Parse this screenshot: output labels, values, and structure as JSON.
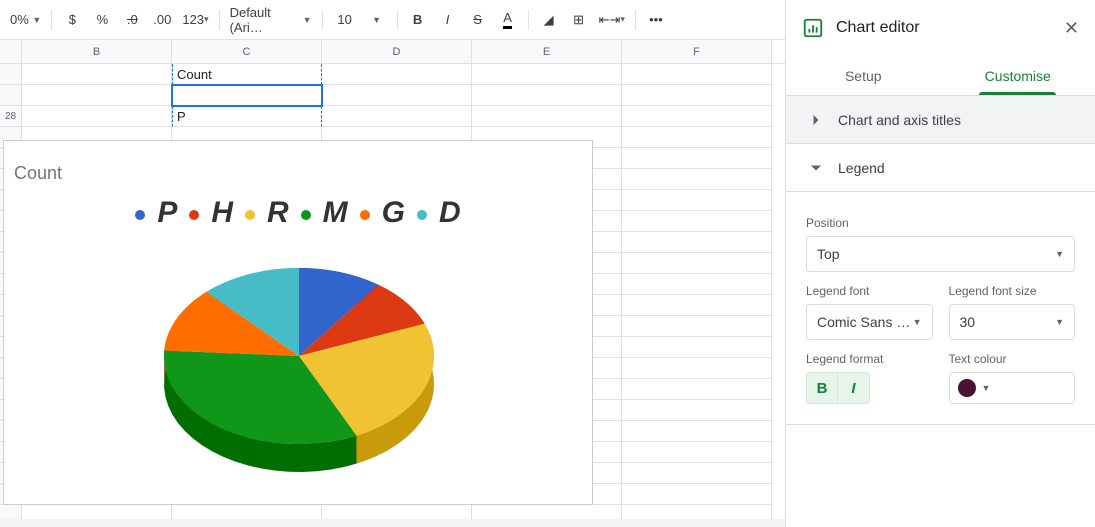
{
  "toolbar": {
    "pct": "0%",
    "currency": "$",
    "percent": "%",
    "dec_dec": ".0",
    "dec_inc": ".00",
    "fmt123": "123",
    "font_name": "Default (Ari…",
    "font_size": "10",
    "more": "•••"
  },
  "grid": {
    "cols": [
      "B",
      "C",
      "D",
      "E",
      "F"
    ],
    "c1": "Count",
    "c2": "P",
    "row3_label": "28"
  },
  "chart_data": {
    "type": "pie",
    "title": "Count",
    "legend_position": "top",
    "legend_font": "Comic Sans MS",
    "legend_font_size": 30,
    "legend_bold": true,
    "legend_italic": true,
    "series": [
      {
        "name": "P",
        "value": 10,
        "color": "#3366cc"
      },
      {
        "name": "H",
        "value": 9,
        "color": "#dc3912"
      },
      {
        "name": "R",
        "value": 24,
        "color": "#f1c232"
      },
      {
        "name": "M",
        "value": 33,
        "color": "#109618"
      },
      {
        "name": "G",
        "value": 12,
        "color": "#ff6d01"
      },
      {
        "name": "D",
        "value": 12,
        "color": "#46bdc6"
      }
    ]
  },
  "panel": {
    "title": "Chart editor",
    "tab_setup": "Setup",
    "tab_customise": "Customise",
    "sec_titles": "Chart and axis titles",
    "sec_legend": "Legend",
    "position_label": "Position",
    "position_value": "Top",
    "font_label": "Legend font",
    "font_value": "Comic Sans …",
    "size_label": "Legend font size",
    "size_value": "30",
    "format_label": "Legend format",
    "color_label": "Text colour",
    "text_color": "#4a1130"
  }
}
